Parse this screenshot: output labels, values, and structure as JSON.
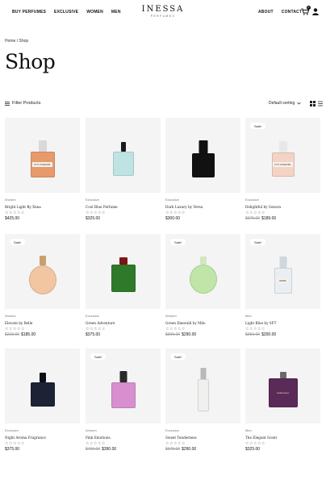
{
  "header": {
    "nav_left": [
      "BUY PERFUMES",
      "EXCLUSIVE",
      "WOMEN",
      "MEN"
    ],
    "nav_right": [
      "ABOUT",
      "CONTACT"
    ],
    "logo": "INESSA",
    "logo_sub": "PERFUMES",
    "cart_count": "0"
  },
  "breadcrumb": "Home / Shop",
  "page_title": "Shop",
  "toolbar": {
    "filter_label": "Filter Products",
    "sort_label": "Default sorting"
  },
  "products": [
    {
      "category": "Women",
      "name": "Bright Light By Xena",
      "stars": "☆☆☆☆☆",
      "old_price": "",
      "price": "$425.00",
      "sale": ""
    },
    {
      "category": "Exclusive",
      "name": "Cool Blue Perfume",
      "stars": "☆☆☆☆☆",
      "old_price": "",
      "price": "$325.00",
      "sale": ""
    },
    {
      "category": "Exclusive",
      "name": "Dark Luxury by Versa",
      "stars": "☆☆☆☆☆",
      "old_price": "",
      "price": "$300.00",
      "sale": ""
    },
    {
      "category": "Exclusive",
      "name": "Delightful by Sonora",
      "stars": "☆☆☆☆☆",
      "old_price": "$375.00",
      "price": "$189.00",
      "sale": "Sale!"
    },
    {
      "category": "Women",
      "name": "Elevate by Belle",
      "stars": "☆☆☆☆☆",
      "old_price": "$215.00",
      "price": "$185.00",
      "sale": "Sale!"
    },
    {
      "category": "Exclusive",
      "name": "Green Adventure",
      "stars": "☆☆☆☆☆",
      "old_price": "",
      "price": "$375.00",
      "sale": ""
    },
    {
      "category": "Women",
      "name": "Green Emerald by Milo",
      "stars": "☆☆☆☆☆",
      "old_price": "$305.00",
      "price": "$290.00",
      "sale": "Sale!"
    },
    {
      "category": "Men",
      "name": "Light Blue by SFT",
      "stars": "☆☆☆☆☆",
      "old_price": "$250.00",
      "price": "$200.00",
      "sale": "Sale!"
    },
    {
      "category": "Exclusive",
      "name": "Night Aroma Fragrance",
      "stars": "☆☆☆☆☆",
      "old_price": "",
      "price": "$375.00",
      "sale": ""
    },
    {
      "category": "Women",
      "name": "Pink Emotions",
      "stars": "☆☆☆☆☆",
      "old_price": "$405.00",
      "price": "$390.00",
      "sale": "Sale!"
    },
    {
      "category": "Exclusive",
      "name": "Sweet Tenderness",
      "stars": "☆☆☆☆☆",
      "old_price": "$375.00",
      "price": "$290.00",
      "sale": "Sale!"
    },
    {
      "category": "Men",
      "name": "The Elegant Scent",
      "stars": "☆☆☆☆☆",
      "old_price": "",
      "price": "$325.00",
      "sale": ""
    }
  ],
  "bottle_labels": [
    "N°5 CHANEL",
    "",
    "",
    "N°5 CHANEL",
    "",
    "",
    "",
    "ZARA",
    "",
    "",
    "",
    "bakaragia"
  ],
  "bottle_colors": [
    "#e89a6a",
    "#bfe3e2",
    "#111111",
    "#f5d3c4",
    "#f1c6a0",
    "#2e7a2a",
    "#bfe6a8",
    "#e9eef2",
    "#1b2335",
    "#d78fcf",
    "#f0f0ee",
    "#5a2a58"
  ]
}
